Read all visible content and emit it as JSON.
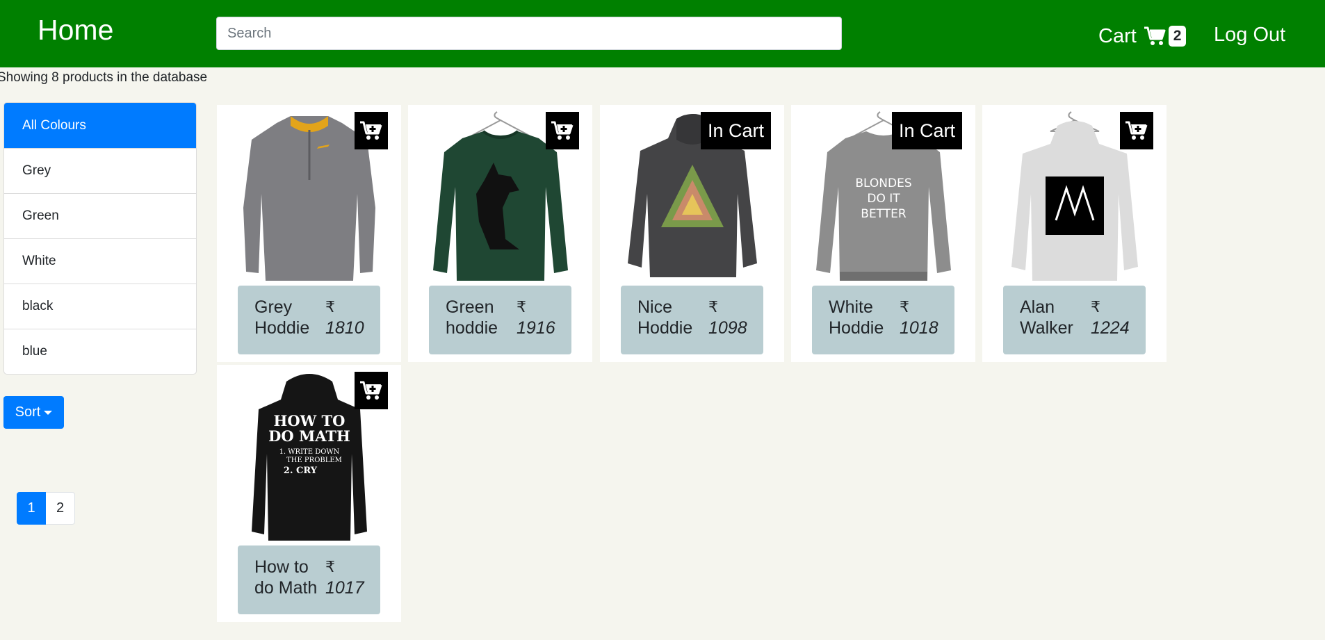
{
  "header": {
    "brand": "Home",
    "search_placeholder": "Search",
    "cart_label": "Cart",
    "cart_count": "2",
    "logout_label": "Log Out"
  },
  "summary": "Showing 8 products in the database",
  "colors": {
    "items": [
      "All Colours",
      "Grey",
      "Green",
      "White",
      "black",
      "blue"
    ],
    "active": "All Colours"
  },
  "sort_label": "Sort",
  "pagination": {
    "pages": [
      "1",
      "2"
    ],
    "active": "1"
  },
  "currency": "₹",
  "products": [
    {
      "name_line1": "Grey",
      "name_line2": "Hoddie",
      "price": "1810",
      "in_cart": false,
      "in_cart_label": "",
      "image": "grey-zip-sweater"
    },
    {
      "name_line1": "Green",
      "name_line2": "hoddie",
      "price": "1916",
      "in_cart": false,
      "in_cart_label": "",
      "image": "green-fox-sweatshirt"
    },
    {
      "name_line1": "Nice",
      "name_line2": "Hoddie",
      "price": "1098",
      "in_cart": true,
      "in_cart_label": "In Cart",
      "image": "dark-grey-triangle-hoodie"
    },
    {
      "name_line1": "White",
      "name_line2": "Hoddie",
      "price": "1018",
      "in_cart": true,
      "in_cart_label": "In Cart",
      "image": "grey-blondes-sweatshirt",
      "print_lines": [
        "BLONDES",
        "DO IT",
        "BETTER"
      ]
    },
    {
      "name_line1": "Alan",
      "name_line2": "Walker",
      "price": "1224",
      "in_cart": false,
      "in_cart_label": "",
      "image": "white-alan-walker-hoodie"
    },
    {
      "name_line1": "How to",
      "name_line2": "do Math",
      "price": "1017",
      "in_cart": false,
      "in_cart_label": "",
      "image": "black-math-hoodie",
      "print_lines": [
        "HOW TO",
        "DO MATH",
        "1. WRITE DOWN",
        "THE PROBLEM",
        "2. CRY"
      ]
    }
  ],
  "icons": {
    "cart": "cart-icon",
    "add_to_cart": "cart-plus-icon"
  },
  "theme": {
    "header_bg": "#008000",
    "accent": "#007bff",
    "background": "#f5f5ee",
    "info_box": "#b9cdd1"
  }
}
